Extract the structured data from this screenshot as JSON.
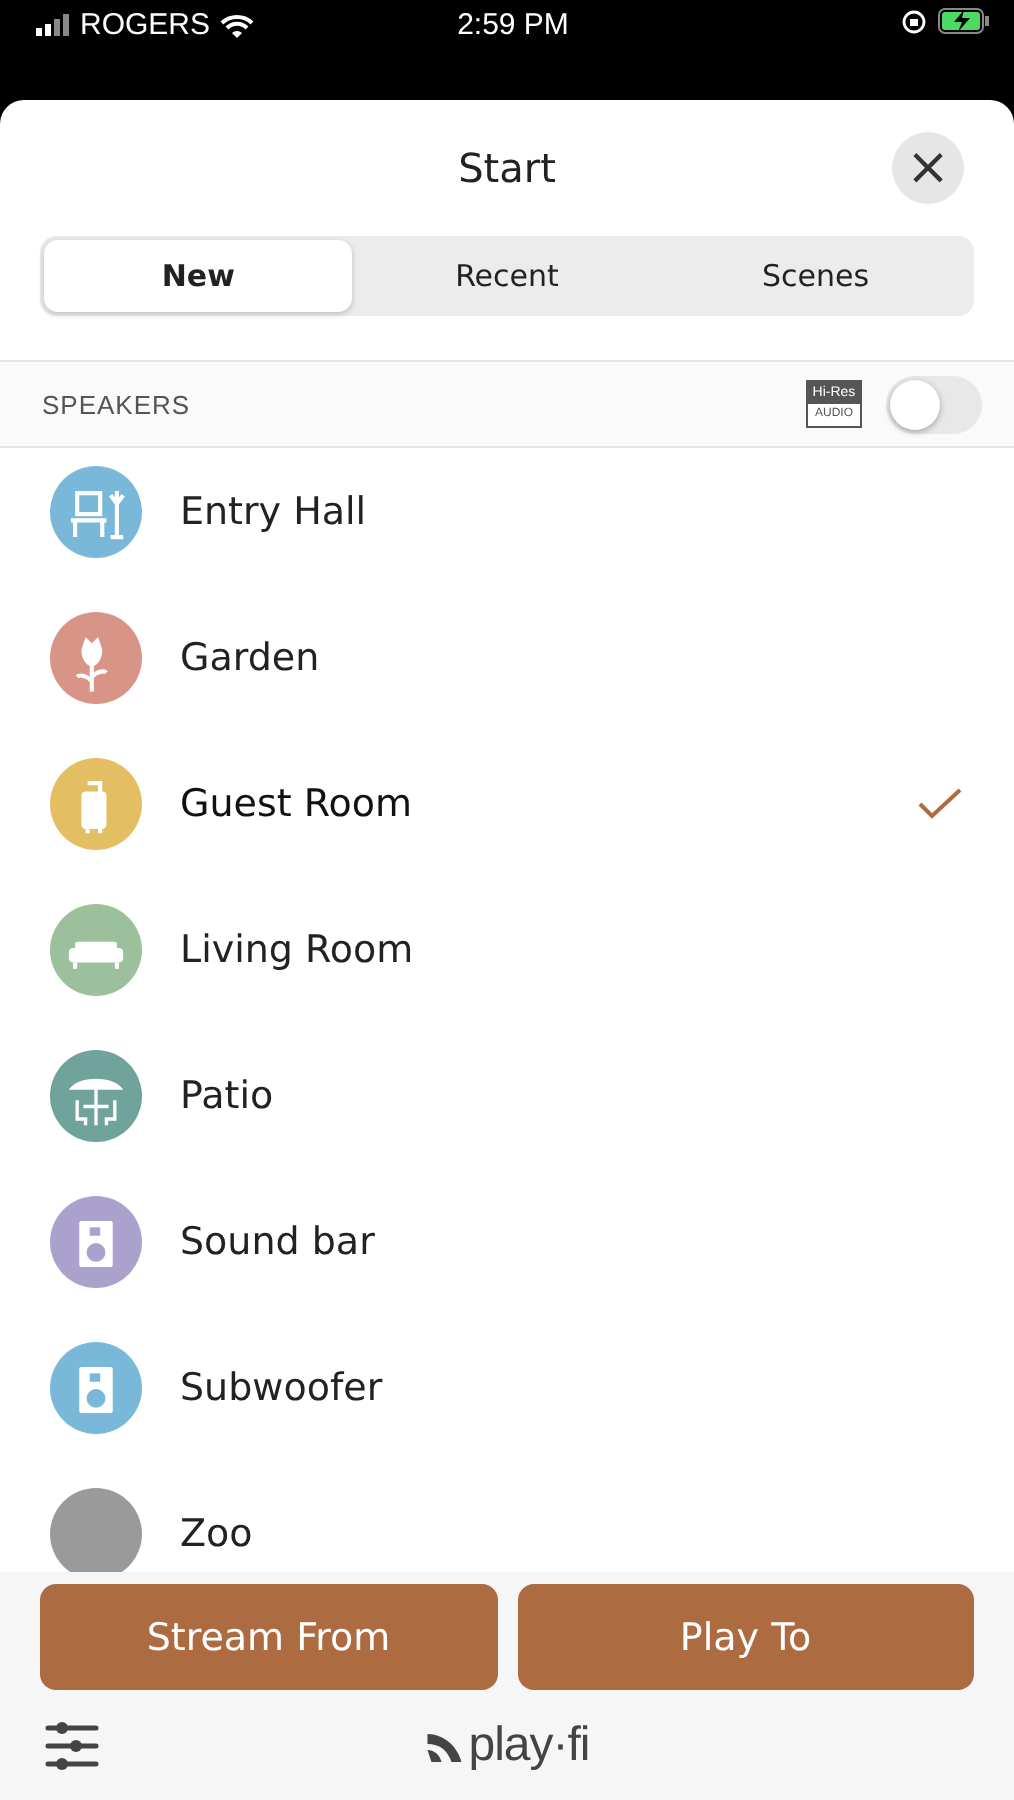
{
  "status_bar": {
    "carrier": "ROGERS",
    "time": "2:59 PM",
    "battery_charging": true
  },
  "sheet": {
    "title": "Start",
    "close": "×"
  },
  "tabs": [
    {
      "label": "New",
      "selected": true
    },
    {
      "label": "Recent",
      "selected": false
    },
    {
      "label": "Scenes",
      "selected": false
    }
  ],
  "section": {
    "title": "SPEAKERS",
    "hires_badge": {
      "top": "Hi-Res",
      "bottom": "AUDIO"
    },
    "hires_on": false
  },
  "speakers": [
    {
      "name": "Entry Hall",
      "kind": "hall",
      "color": "#79b8d8",
      "selected": false
    },
    {
      "name": "Garden",
      "kind": "flower",
      "color": "#d99488",
      "selected": false
    },
    {
      "name": "Guest Room",
      "kind": "luggage",
      "color": "#e3be62",
      "selected": true
    },
    {
      "name": "Living Room",
      "kind": "sofa",
      "color": "#9cc09c",
      "selected": false
    },
    {
      "name": "Patio",
      "kind": "patio",
      "color": "#6fa39b",
      "selected": false
    },
    {
      "name": "Sound bar",
      "kind": "speaker",
      "color": "#aaa2cc",
      "selected": false
    },
    {
      "name": "Subwoofer",
      "kind": "speaker",
      "color": "#79b8d8",
      "selected": false
    },
    {
      "name": "Zoo",
      "kind": "other",
      "color": "#9a9a9a",
      "selected": false
    }
  ],
  "actions": [
    "Stream From",
    "Play To"
  ],
  "footer": {
    "logo": "play·fi"
  }
}
